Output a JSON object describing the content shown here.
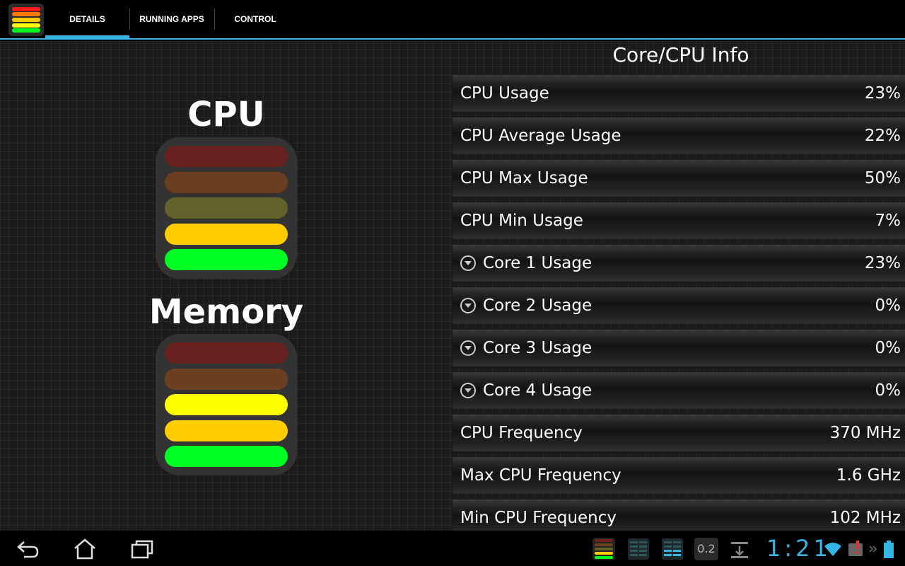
{
  "tabs": [
    "DETAILS",
    "RUNNING APPS",
    "CONTROL"
  ],
  "colors": {
    "accent": "#33b5e5",
    "red": "#ff1a1a",
    "orange": "#ff7a00",
    "yellow": "#ffff00",
    "amber": "#ffcc00",
    "green": "#00ff22",
    "dim_red": "#6b2020",
    "dim_orange": "#6b3e20",
    "dim_olive": "#62622a"
  },
  "left": {
    "cpu_title": "CPU",
    "memory_title": "Memory",
    "cpu_bars": [
      "dim_red",
      "dim_orange",
      "dim_olive",
      "amber",
      "green"
    ],
    "memory_bars": [
      "dim_red",
      "dim_orange",
      "yellow",
      "amber",
      "green"
    ]
  },
  "panel": {
    "title": "Core/CPU Info",
    "rows": [
      {
        "label": "CPU Usage",
        "value": "23%",
        "expandable": false
      },
      {
        "label": "CPU Average Usage",
        "value": "22%",
        "expandable": false
      },
      {
        "label": "CPU Max Usage",
        "value": "50%",
        "expandable": false
      },
      {
        "label": "CPU Min Usage",
        "value": "7%",
        "expandable": false
      },
      {
        "label": "Core 1 Usage",
        "value": "23%",
        "expandable": true
      },
      {
        "label": "Core 2 Usage",
        "value": "0%",
        "expandable": true
      },
      {
        "label": "Core 3 Usage",
        "value": "0%",
        "expandable": true
      },
      {
        "label": "Core 4 Usage",
        "value": "0%",
        "expandable": true
      },
      {
        "label": "CPU Frequency",
        "value": "370 MHz",
        "expandable": false
      },
      {
        "label": "Max CPU Frequency",
        "value": "1.6 GHz",
        "expandable": false
      },
      {
        "label": "Min CPU Frequency",
        "value": "102 MHz",
        "expandable": false
      }
    ]
  },
  "systembar": {
    "clock": "1:21",
    "load": "0.2",
    "icons": [
      "back-icon",
      "home-icon",
      "recent-apps-icon",
      "cpu-meter-icon",
      "memory-grid-icon",
      "memory-grid-active-icon",
      "download-icon",
      "wifi-icon",
      "keyboard-icon",
      "battery-icon"
    ]
  }
}
